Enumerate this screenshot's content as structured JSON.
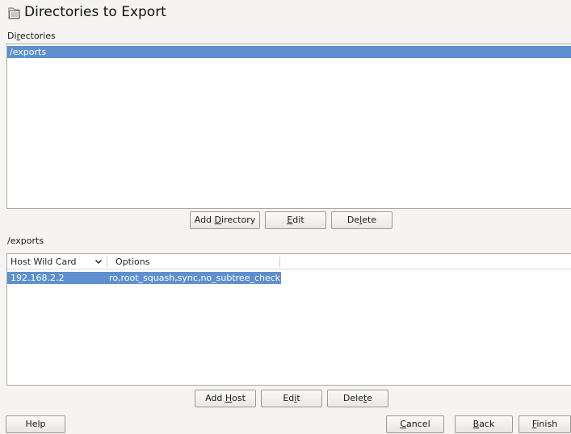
{
  "title": "Directories to Export",
  "directories": {
    "label": "Directories",
    "label_mnemonic": "r",
    "items": [
      "/exports"
    ],
    "selected_index": 0,
    "buttons": {
      "add": "Add Directory",
      "edit": "Edit",
      "delete": "Delete"
    }
  },
  "hosts": {
    "label": "/exports",
    "columns": [
      "Host Wild Card",
      "Options"
    ],
    "rows": [
      {
        "host": "192.168.2.2",
        "options": "ro,root_squash,sync,no_subtree_check"
      }
    ],
    "buttons": {
      "add": "Add Host",
      "edit": "Edit",
      "delete": "Delete"
    }
  },
  "footer": {
    "help": "Help",
    "cancel": "Cancel",
    "back": "Back",
    "finish": "Finish"
  },
  "colors": {
    "selection": "#5e8fce",
    "background": "#f5f4f2"
  },
  "icons": {
    "title": "folder-icon",
    "sort": "chevron-down-icon"
  }
}
